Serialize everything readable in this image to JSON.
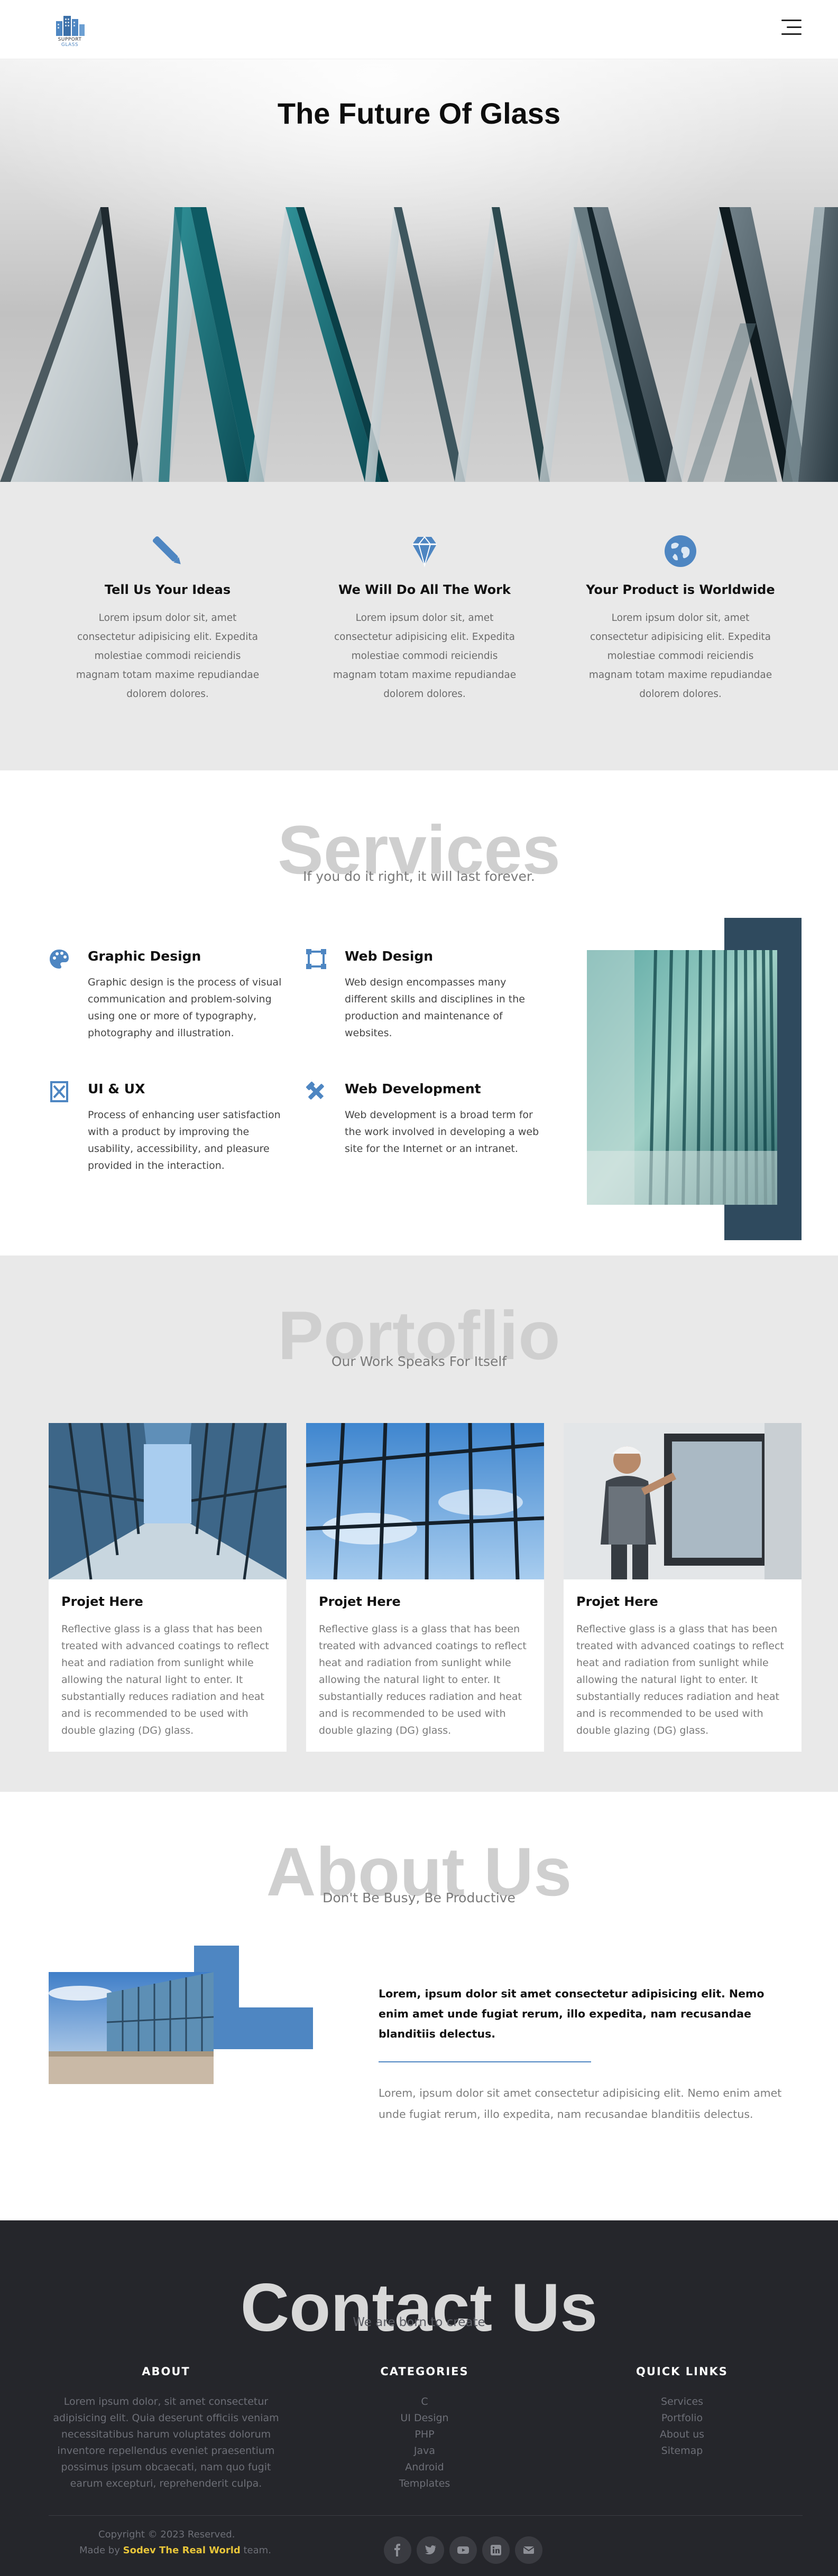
{
  "nav": {
    "logo_main": "SUPPORT",
    "logo_accent": "GLASS",
    "menu_icon": "hamburger-menu-icon"
  },
  "hero": {
    "title": "The Future Of Glass"
  },
  "features": [
    {
      "icon": "pen-icon",
      "title": "Tell Us Your Ideas",
      "text": "Lorem ipsum dolor sit, amet consectetur adipisicing elit. Expedita molestiae commodi reiciendis magnam totam maxime repudiandae dolorem dolores."
    },
    {
      "icon": "diamond-icon",
      "title": "We Will Do All The Work",
      "text": "Lorem ipsum dolor sit, amet consectetur adipisicing elit. Expedita molestiae commodi reiciendis magnam totam maxime repudiandae dolorem dolores."
    },
    {
      "icon": "globe-icon",
      "title": "Your Product is Worldwide",
      "text": "Lorem ipsum dolor sit, amet consectetur adipisicing elit. Expedita molestiae commodi reiciendis magnam totam maxime repudiandae dolorem dolores."
    }
  ],
  "services": {
    "heading": "Services",
    "subheading": "If you do it right, it will last forever.",
    "items": [
      {
        "icon": "palette-icon",
        "title": "Graphic Design",
        "text": "Graphic design is the process of visual communication and problem-solving using one or more of typography, photography and illustration."
      },
      {
        "icon": "web-design-icon",
        "title": "Web Design",
        "text": "Web design encompasses many different skills and disciplines in the production and maintenance of websites."
      },
      {
        "icon": "ui-ux-icon",
        "title": "UI & UX",
        "text": "Process of enhancing user satisfaction with a product by improving the usability, accessibility, and pleasure provided in the interaction."
      },
      {
        "icon": "tools-icon",
        "title": "Web Development",
        "text": "Web development is a broad term for the work involved in developing a web site for the Internet or an intranet."
      }
    ]
  },
  "portfolio": {
    "heading": "Portoflio",
    "subheading": "Our Work Speaks For Itself",
    "cards": [
      {
        "title": "Projet Here",
        "text": "Reflective glass is a glass that has been treated with advanced coatings to reflect heat and radiation from sunlight while allowing the natural light to enter. It substantially reduces radiation and heat and is recommended to be used with double glazing (DG) glass."
      },
      {
        "title": "Projet Here",
        "text": "Reflective glass is a glass that has been treated with advanced coatings to reflect heat and radiation from sunlight while allowing the natural light to enter. It substantially reduces radiation and heat and is recommended to be used with double glazing (DG) glass."
      },
      {
        "title": "Projet Here",
        "text": "Reflective glass is a glass that has been treated with advanced coatings to reflect heat and radiation from sunlight while allowing the natural light to enter. It substantially reduces radiation and heat and is recommended to be used with double glazing (DG) glass."
      }
    ]
  },
  "about": {
    "heading": "About Us",
    "subheading": "Don't Be Busy, Be Productive",
    "bold_text": "Lorem, ipsum dolor sit amet consectetur adipisicing elit. Nemo enim amet unde fugiat rerum, illo expedita, nam recusandae blanditiis delectus.",
    "text": "Lorem, ipsum dolor sit amet consectetur adipisicing elit. Nemo enim amet unde fugiat rerum, illo expedita, nam recusandae blanditiis delectus."
  },
  "footer": {
    "heading": "Contact Us",
    "subheading": "We are born to create",
    "about": {
      "title": "ABOUT",
      "text": "Lorem ipsum dolor, sit amet consectetur adipisicing elit. Quia deserunt officiis veniam necessitatibus harum voluptates dolorum inventore repellendus eveniet praesentium possimus ipsum obcaecati, nam quo fugit earum excepturi, reprehenderit culpa."
    },
    "categories": {
      "title": "CATEGORIES",
      "items": [
        "C",
        "UI Design",
        "PHP",
        "Java",
        "Android",
        "Templates"
      ]
    },
    "quick_links": {
      "title": "QUICK LINKS",
      "items": [
        "Services",
        "Portfolio",
        "About us",
        "Sitemap"
      ]
    },
    "copyright": "Copyright © 2023 Reserved.",
    "made_by_prefix": "Made by",
    "made_by_name": "Sodev The Real World",
    "made_by_suffix": "team.",
    "socials": [
      "facebook-icon",
      "twitter-icon",
      "youtube-icon",
      "linkedin-icon",
      "email-icon"
    ]
  },
  "colors": {
    "accent": "#4e86c2",
    "footer_bg": "#25262b",
    "section_bg": "#e9e9e9",
    "frame": "#2f4a5e",
    "highlight": "#e8c53a"
  }
}
